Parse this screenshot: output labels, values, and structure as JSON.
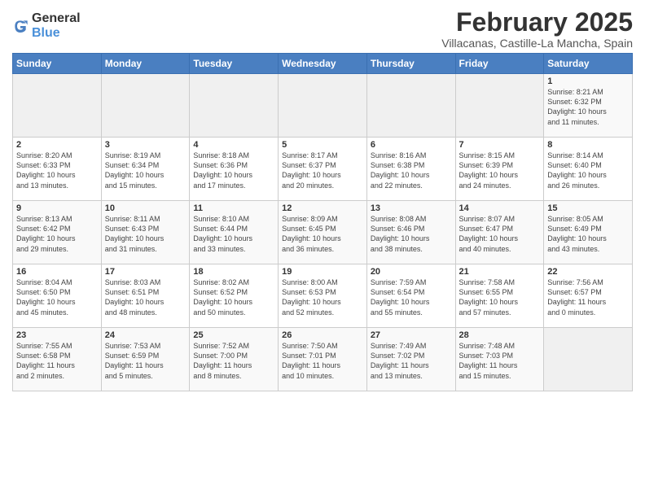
{
  "logo": {
    "general": "General",
    "blue": "Blue"
  },
  "title": "February 2025",
  "location": "Villacanas, Castille-La Mancha, Spain",
  "days_of_week": [
    "Sunday",
    "Monday",
    "Tuesday",
    "Wednesday",
    "Thursday",
    "Friday",
    "Saturday"
  ],
  "weeks": [
    [
      {
        "day": "",
        "info": ""
      },
      {
        "day": "",
        "info": ""
      },
      {
        "day": "",
        "info": ""
      },
      {
        "day": "",
        "info": ""
      },
      {
        "day": "",
        "info": ""
      },
      {
        "day": "",
        "info": ""
      },
      {
        "day": "1",
        "info": "Sunrise: 8:21 AM\nSunset: 6:32 PM\nDaylight: 10 hours\nand 11 minutes."
      }
    ],
    [
      {
        "day": "2",
        "info": "Sunrise: 8:20 AM\nSunset: 6:33 PM\nDaylight: 10 hours\nand 13 minutes."
      },
      {
        "day": "3",
        "info": "Sunrise: 8:19 AM\nSunset: 6:34 PM\nDaylight: 10 hours\nand 15 minutes."
      },
      {
        "day": "4",
        "info": "Sunrise: 8:18 AM\nSunset: 6:36 PM\nDaylight: 10 hours\nand 17 minutes."
      },
      {
        "day": "5",
        "info": "Sunrise: 8:17 AM\nSunset: 6:37 PM\nDaylight: 10 hours\nand 20 minutes."
      },
      {
        "day": "6",
        "info": "Sunrise: 8:16 AM\nSunset: 6:38 PM\nDaylight: 10 hours\nand 22 minutes."
      },
      {
        "day": "7",
        "info": "Sunrise: 8:15 AM\nSunset: 6:39 PM\nDaylight: 10 hours\nand 24 minutes."
      },
      {
        "day": "8",
        "info": "Sunrise: 8:14 AM\nSunset: 6:40 PM\nDaylight: 10 hours\nand 26 minutes."
      }
    ],
    [
      {
        "day": "9",
        "info": "Sunrise: 8:13 AM\nSunset: 6:42 PM\nDaylight: 10 hours\nand 29 minutes."
      },
      {
        "day": "10",
        "info": "Sunrise: 8:11 AM\nSunset: 6:43 PM\nDaylight: 10 hours\nand 31 minutes."
      },
      {
        "day": "11",
        "info": "Sunrise: 8:10 AM\nSunset: 6:44 PM\nDaylight: 10 hours\nand 33 minutes."
      },
      {
        "day": "12",
        "info": "Sunrise: 8:09 AM\nSunset: 6:45 PM\nDaylight: 10 hours\nand 36 minutes."
      },
      {
        "day": "13",
        "info": "Sunrise: 8:08 AM\nSunset: 6:46 PM\nDaylight: 10 hours\nand 38 minutes."
      },
      {
        "day": "14",
        "info": "Sunrise: 8:07 AM\nSunset: 6:47 PM\nDaylight: 10 hours\nand 40 minutes."
      },
      {
        "day": "15",
        "info": "Sunrise: 8:05 AM\nSunset: 6:49 PM\nDaylight: 10 hours\nand 43 minutes."
      }
    ],
    [
      {
        "day": "16",
        "info": "Sunrise: 8:04 AM\nSunset: 6:50 PM\nDaylight: 10 hours\nand 45 minutes."
      },
      {
        "day": "17",
        "info": "Sunrise: 8:03 AM\nSunset: 6:51 PM\nDaylight: 10 hours\nand 48 minutes."
      },
      {
        "day": "18",
        "info": "Sunrise: 8:02 AM\nSunset: 6:52 PM\nDaylight: 10 hours\nand 50 minutes."
      },
      {
        "day": "19",
        "info": "Sunrise: 8:00 AM\nSunset: 6:53 PM\nDaylight: 10 hours\nand 52 minutes."
      },
      {
        "day": "20",
        "info": "Sunrise: 7:59 AM\nSunset: 6:54 PM\nDaylight: 10 hours\nand 55 minutes."
      },
      {
        "day": "21",
        "info": "Sunrise: 7:58 AM\nSunset: 6:55 PM\nDaylight: 10 hours\nand 57 minutes."
      },
      {
        "day": "22",
        "info": "Sunrise: 7:56 AM\nSunset: 6:57 PM\nDaylight: 11 hours\nand 0 minutes."
      }
    ],
    [
      {
        "day": "23",
        "info": "Sunrise: 7:55 AM\nSunset: 6:58 PM\nDaylight: 11 hours\nand 2 minutes."
      },
      {
        "day": "24",
        "info": "Sunrise: 7:53 AM\nSunset: 6:59 PM\nDaylight: 11 hours\nand 5 minutes."
      },
      {
        "day": "25",
        "info": "Sunrise: 7:52 AM\nSunset: 7:00 PM\nDaylight: 11 hours\nand 8 minutes."
      },
      {
        "day": "26",
        "info": "Sunrise: 7:50 AM\nSunset: 7:01 PM\nDaylight: 11 hours\nand 10 minutes."
      },
      {
        "day": "27",
        "info": "Sunrise: 7:49 AM\nSunset: 7:02 PM\nDaylight: 11 hours\nand 13 minutes."
      },
      {
        "day": "28",
        "info": "Sunrise: 7:48 AM\nSunset: 7:03 PM\nDaylight: 11 hours\nand 15 minutes."
      },
      {
        "day": "",
        "info": ""
      }
    ]
  ]
}
